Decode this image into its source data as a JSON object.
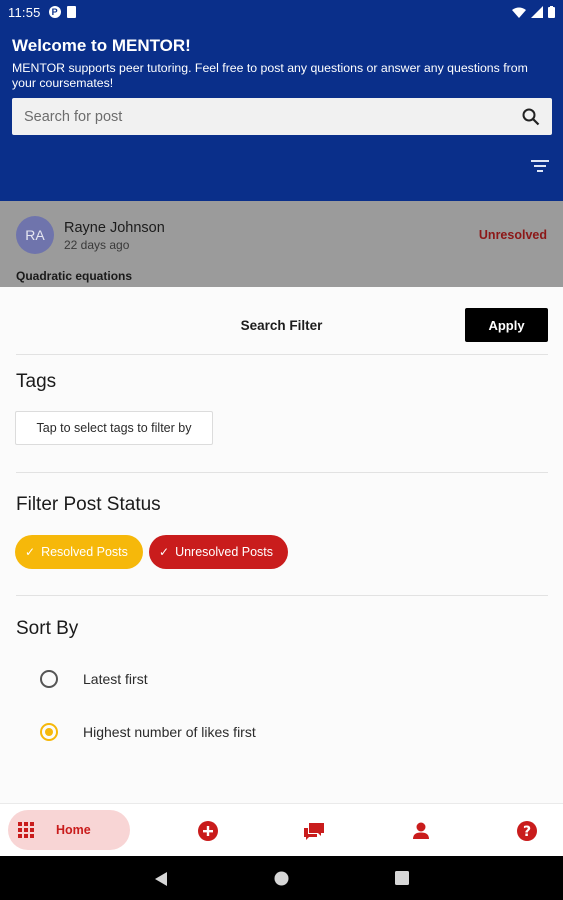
{
  "status_bar": {
    "time": "11:55",
    "left_icons": [
      "p-badge-icon",
      "sim-card-icon"
    ],
    "right_icons": [
      "wifi-icon",
      "signal-icon",
      "battery-icon"
    ]
  },
  "header": {
    "title": "Welcome to MENTOR!",
    "subtitle": "MENTOR supports peer tutoring. Feel free to post any questions or answer any questions from your coursemates!",
    "search_placeholder": "Search for post",
    "search_icon": "search-icon",
    "filter_icon": "filter-icon",
    "color": "#0a2f8a"
  },
  "post": {
    "avatar_initials": "RA",
    "author": "Rayne Johnson",
    "time": "22 days ago",
    "status": "Unresolved",
    "title": "Quadratic equations"
  },
  "filter_sheet": {
    "title": "Search Filter",
    "apply_label": "Apply",
    "tags_heading": "Tags",
    "tags_button": "Tap to select tags to filter by",
    "status_heading": "Filter Post Status",
    "chips": [
      {
        "label": "Resolved Posts",
        "selected": true,
        "color": "#f6b80a"
      },
      {
        "label": "Unresolved Posts",
        "selected": true,
        "color": "#c91c1c"
      }
    ],
    "sort_heading": "Sort By",
    "sort_options": [
      {
        "label": "Latest first",
        "selected": false
      },
      {
        "label": "Highest number of likes first",
        "selected": true
      }
    ]
  },
  "bottom_nav": {
    "items": [
      {
        "label": "Home",
        "icon": "grid-icon",
        "active": true
      },
      {
        "label": "",
        "icon": "add-circle-icon"
      },
      {
        "label": "",
        "icon": "chat-icon"
      },
      {
        "label": "",
        "icon": "person-icon"
      },
      {
        "label": "",
        "icon": "help-icon"
      }
    ],
    "accent": "#c91c1c"
  },
  "system_nav": [
    "back-icon",
    "home-circle-icon",
    "recents-icon"
  ]
}
